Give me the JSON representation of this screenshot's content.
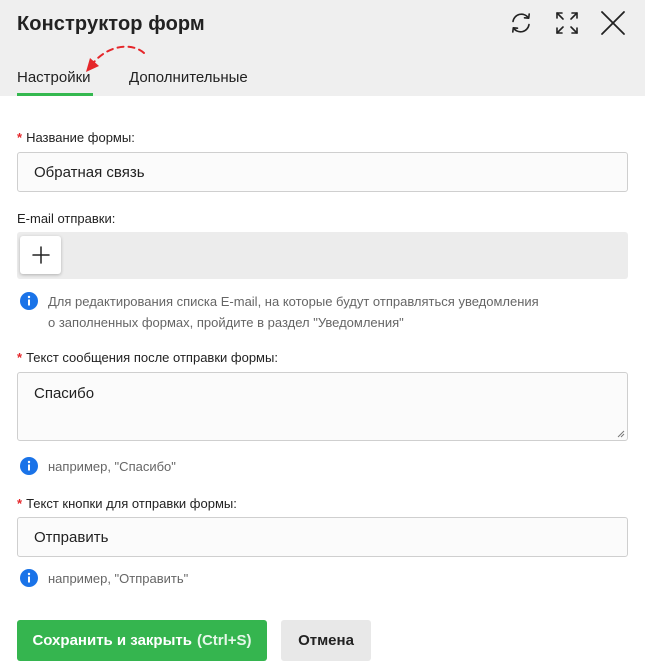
{
  "dialog": {
    "title": "Конструктор форм"
  },
  "tabs": [
    {
      "label": "Настройки",
      "active": true
    },
    {
      "label": "Дополнительные",
      "active": false
    }
  ],
  "form": {
    "name": {
      "required_mark": "*",
      "label": "Название формы:",
      "value": "Обратная связь"
    },
    "email": {
      "label": "E-mail отправки:",
      "add_icon": "plus-icon",
      "hint_line1": "Для редактирования списка E-mail, на которые будут отправляться уведомления",
      "hint_line2": "о заполненных формах, пройдите в раздел \"Уведомления\""
    },
    "success_message": {
      "required_mark": "*",
      "label": "Текст сообщения после отправки формы:",
      "value": "Спасибо",
      "hint": "например, \"Спасибо\""
    },
    "submit_text": {
      "required_mark": "*",
      "label": "Текст кнопки для отправки формы:",
      "value": "Отправить",
      "hint": "например, \"Отправить\""
    }
  },
  "footer": {
    "save_label": "Сохранить и закрыть",
    "save_shortcut": "(Ctrl+S)",
    "cancel_label": "Отмена"
  },
  "colors": {
    "accent_green": "#35b54f",
    "required_red": "#e5262a",
    "info_blue": "#1a73e8",
    "annotation_red": "#e5262a"
  },
  "icons": {
    "refresh": "refresh-icon",
    "expand": "expand-icon",
    "close": "close-icon",
    "info": "info-icon"
  }
}
